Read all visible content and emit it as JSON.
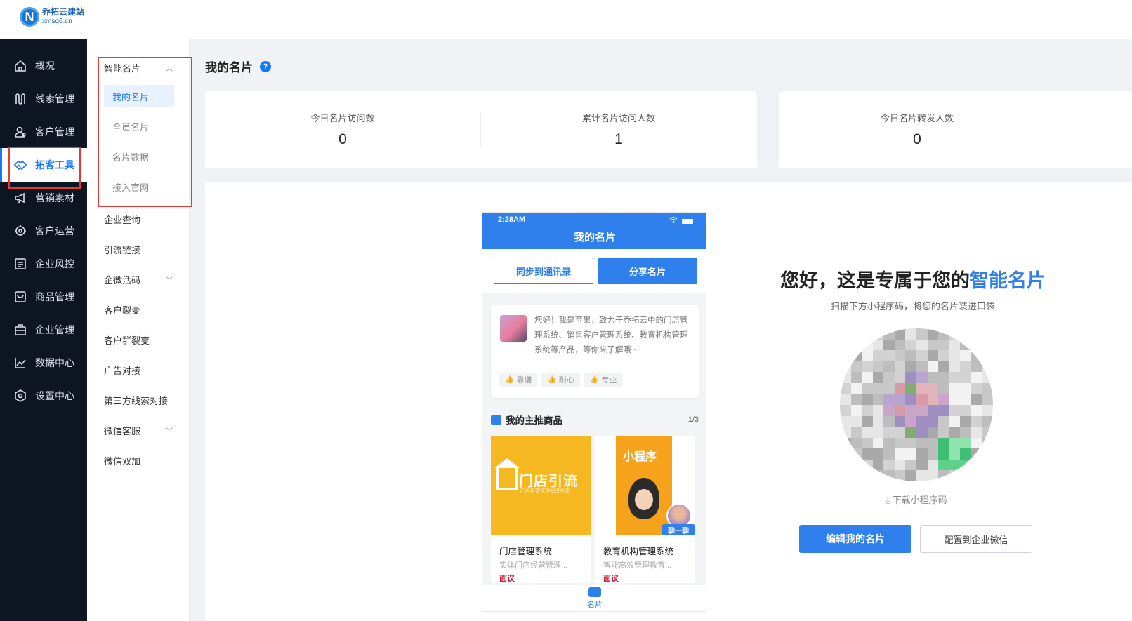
{
  "brand": {
    "name": "乔拓云建站",
    "domain": "xmsq6.cn",
    "logo_letter": "N"
  },
  "sidebar": {
    "items": [
      {
        "label": "概况",
        "icon": "home-icon"
      },
      {
        "label": "线索管理",
        "icon": "leads-icon"
      },
      {
        "label": "客户管理",
        "icon": "customers-icon"
      },
      {
        "label": "拓客工具",
        "icon": "handshake-icon",
        "active": true
      },
      {
        "label": "营销素材",
        "icon": "megaphone-icon"
      },
      {
        "label": "客户运营",
        "icon": "operations-icon"
      },
      {
        "label": "企业风控",
        "icon": "risk-icon"
      },
      {
        "label": "商品管理",
        "icon": "products-icon"
      },
      {
        "label": "企业管理",
        "icon": "briefcase-icon"
      },
      {
        "label": "数据中心",
        "icon": "chart-icon"
      },
      {
        "label": "设置中心",
        "icon": "settings-icon"
      }
    ]
  },
  "submenu": {
    "group": "智能名片",
    "group_children": [
      "我的名片",
      "全员名片",
      "名片数据",
      "接入官网"
    ],
    "items": [
      "企业查询",
      "引流链接",
      "企微活码",
      "客户裂变",
      "客户群裂变",
      "广告对接",
      "第三方线索对接",
      "微信客服",
      "微信双加"
    ]
  },
  "page": {
    "title": "我的名片",
    "help": "?"
  },
  "stats": [
    {
      "label": "今日名片访问数",
      "value": "0"
    },
    {
      "label": "累计名片访问人数",
      "value": "1"
    },
    {
      "label": "今日名片转发人数",
      "value": "0"
    }
  ],
  "phone": {
    "time": "2:28AM",
    "title": "我的名片",
    "sync_button": "同步到通讯录",
    "share_button": "分享名片",
    "intro": "您好！我是苹果，致力于乔拓云中的门店管理系统、销售客户管理系统、教育机构管理系统等产品，等你来了解哦~",
    "tags": [
      "靠谱",
      "耐心",
      "专业"
    ],
    "products_heading": "我的主推商品",
    "products_page": "1/3",
    "products": [
      {
        "name": "门店管理系统",
        "desc": "实体门店经营管理...",
        "price": "面议",
        "img_title": "门店引流",
        "img_sub": "门店经营管理知识分享"
      },
      {
        "name": "教育机构管理系统",
        "desc": "智能高效管理教育...",
        "price": "面议",
        "img_title": "小程序"
      }
    ],
    "chat_badge": "聊一聊",
    "tab_label": "名片"
  },
  "promo": {
    "headline_prefix": "您好，这是专属于您的",
    "headline_highlight": "智能名片",
    "subtitle": "扫描下方小程序码，将您的名片装进口袋",
    "download": "下载小程序码",
    "edit_button": "编辑我的名片",
    "config_button": "配置到企业微信"
  },
  "colors": {
    "accent": "#2f80ed",
    "sidebar_bg": "#0e1624",
    "highlight_border": "#e53935"
  }
}
